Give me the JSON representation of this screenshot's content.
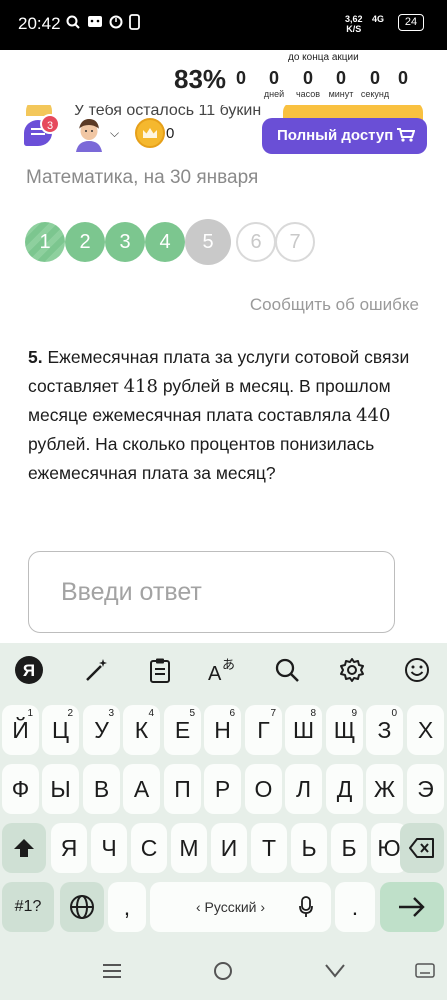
{
  "statusbar": {
    "time": "20:42",
    "net_speed": "3,62",
    "net_unit": "K/S",
    "signal": "4G",
    "battery": "24"
  },
  "promo": {
    "percent": "83%",
    "title": "до конца акции",
    "countdown": [
      {
        "value": "0",
        "unit": ""
      },
      {
        "value": "0",
        "unit": "дней"
      },
      {
        "value": "0",
        "unit": "часов"
      },
      {
        "value": "0",
        "unit": "минут"
      },
      {
        "value": "0",
        "unit": "секунд"
      },
      {
        "value": "0",
        "unit": ""
      }
    ]
  },
  "behind": {
    "text": "У тебя осталось 11 букин"
  },
  "header": {
    "notifications": "3",
    "coins": "0",
    "cta_label": "Полный доступ"
  },
  "page": {
    "subject": "Математика, на 30 января",
    "report": "Сообщить об ошибке"
  },
  "steps": [
    {
      "label": "1",
      "state": "done-striped"
    },
    {
      "label": "2",
      "state": "done"
    },
    {
      "label": "3",
      "state": "done"
    },
    {
      "label": "4",
      "state": "done"
    },
    {
      "label": "5",
      "state": "current"
    },
    {
      "label": "6",
      "state": "todo"
    },
    {
      "label": "7",
      "state": "todo"
    }
  ],
  "task": {
    "number": "5.",
    "part1": " Ежемесячная плата за услуги сотовой связи составляет ",
    "value1": "418",
    "part2": " рублей в месяц. В прошлом месяце ежемесячная плата составляла ",
    "value2": "440",
    "part3": " рублей. На сколько процентов понизилась ежемесячная плата за месяц?"
  },
  "answer": {
    "placeholder": "Введи ответ",
    "value": ""
  },
  "keyboard": {
    "row1": [
      {
        "label": "Й",
        "sup": "1"
      },
      {
        "label": "Ц",
        "sup": "2"
      },
      {
        "label": "У",
        "sup": "3"
      },
      {
        "label": "К",
        "sup": "4"
      },
      {
        "label": "Е",
        "sup": "5"
      },
      {
        "label": "Н",
        "sup": "6"
      },
      {
        "label": "Г",
        "sup": "7"
      },
      {
        "label": "Ш",
        "sup": "8"
      },
      {
        "label": "Щ",
        "sup": "9"
      },
      {
        "label": "З",
        "sup": "0"
      },
      {
        "label": "Х",
        "sup": ""
      }
    ],
    "row2": [
      "Ф",
      "Ы",
      "В",
      "А",
      "П",
      "Р",
      "О",
      "Л",
      "Д",
      "Ж",
      "Э"
    ],
    "row3": [
      "Я",
      "Ч",
      "С",
      "М",
      "И",
      "Т",
      "Ь",
      "Б",
      "Ю"
    ],
    "symbols_label": "#1?",
    "comma": ",",
    "language": "‹ Русский ›",
    "period": "."
  }
}
